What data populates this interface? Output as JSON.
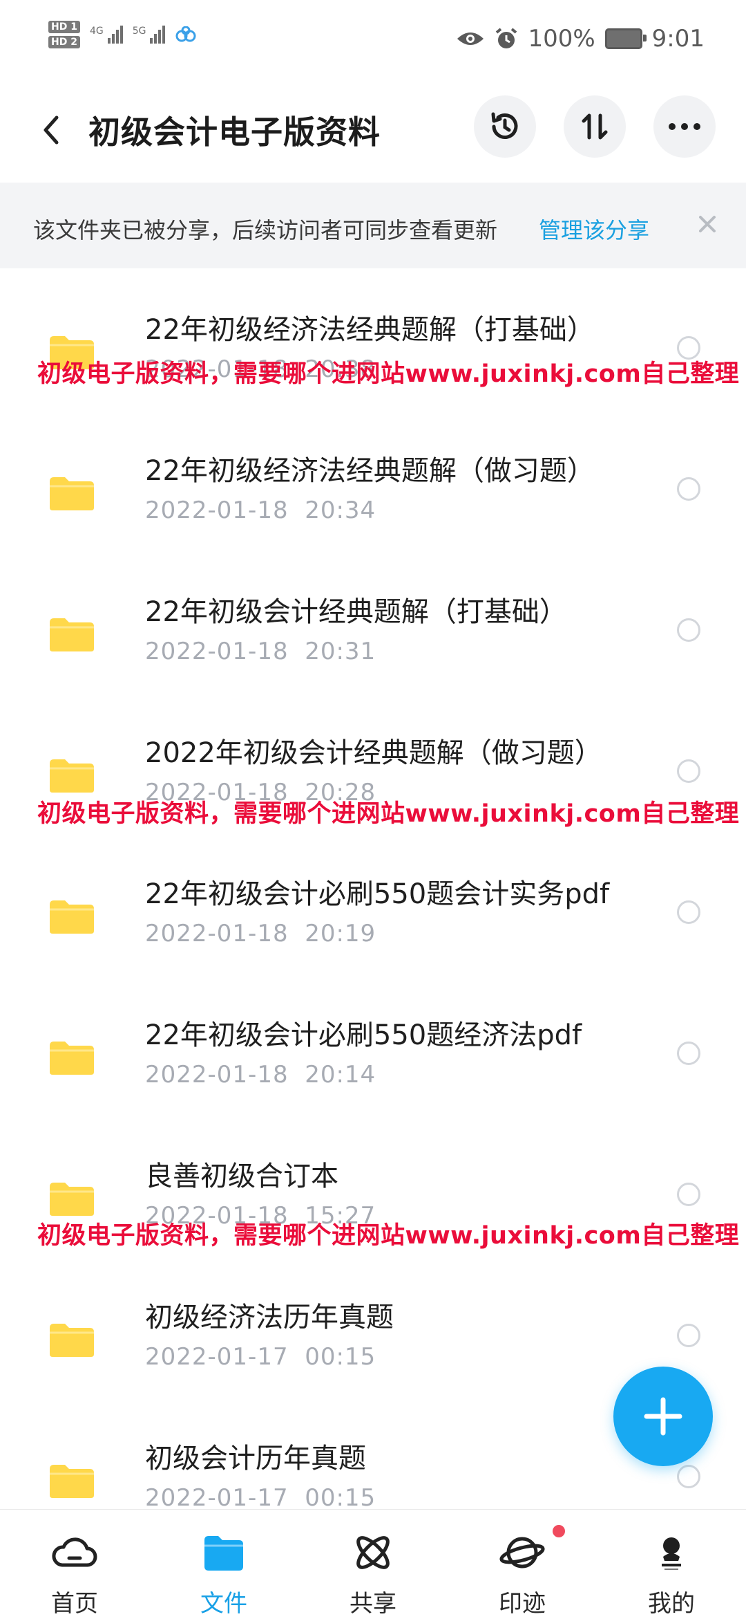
{
  "status_bar": {
    "hd1": "HD 1",
    "hd2": "HD 2",
    "net1": "4G",
    "net2": "5G",
    "battery": "100%",
    "time": "9:01"
  },
  "header": {
    "title": "初级会计电子版资料"
  },
  "banner": {
    "text": "该文件夹已被分享，后续访问者可同步查看更新",
    "link": "管理该分享"
  },
  "files": [
    {
      "name": "22年初级经济法经典题解（打基础）",
      "date": "2022-01-18  20:38"
    },
    {
      "name": "22年初级经济法经典题解（做习题）",
      "date": "2022-01-18  20:34"
    },
    {
      "name": "22年初级会计经典题解（打基础）",
      "date": "2022-01-18  20:31"
    },
    {
      "name": "2022年初级会计经典题解（做习题）",
      "date": "2022-01-18  20:28"
    },
    {
      "name": "22年初级会计必刷550题会计实务pdf",
      "date": "2022-01-18  20:19"
    },
    {
      "name": "22年初级会计必刷550题经济法pdf",
      "date": "2022-01-18  20:14"
    },
    {
      "name": "良善初级合订本",
      "date": "2022-01-18  15:27"
    },
    {
      "name": "初级经济法历年真题",
      "date": "2022-01-17  00:15"
    },
    {
      "name": "初级会计历年真题",
      "date": "2022-01-17  00:15"
    }
  ],
  "watermark": "初级电子版资料，需要哪个进网站www.juxinkj.com自己整理",
  "nav": [
    {
      "label": "首页"
    },
    {
      "label": "文件"
    },
    {
      "label": "共享"
    },
    {
      "label": "印迹"
    },
    {
      "label": "我的"
    }
  ],
  "colors": {
    "accent": "#18a9f2",
    "folder": "#ffd84a",
    "watermark": "#ea0d3a",
    "link": "#1aa0e0"
  }
}
